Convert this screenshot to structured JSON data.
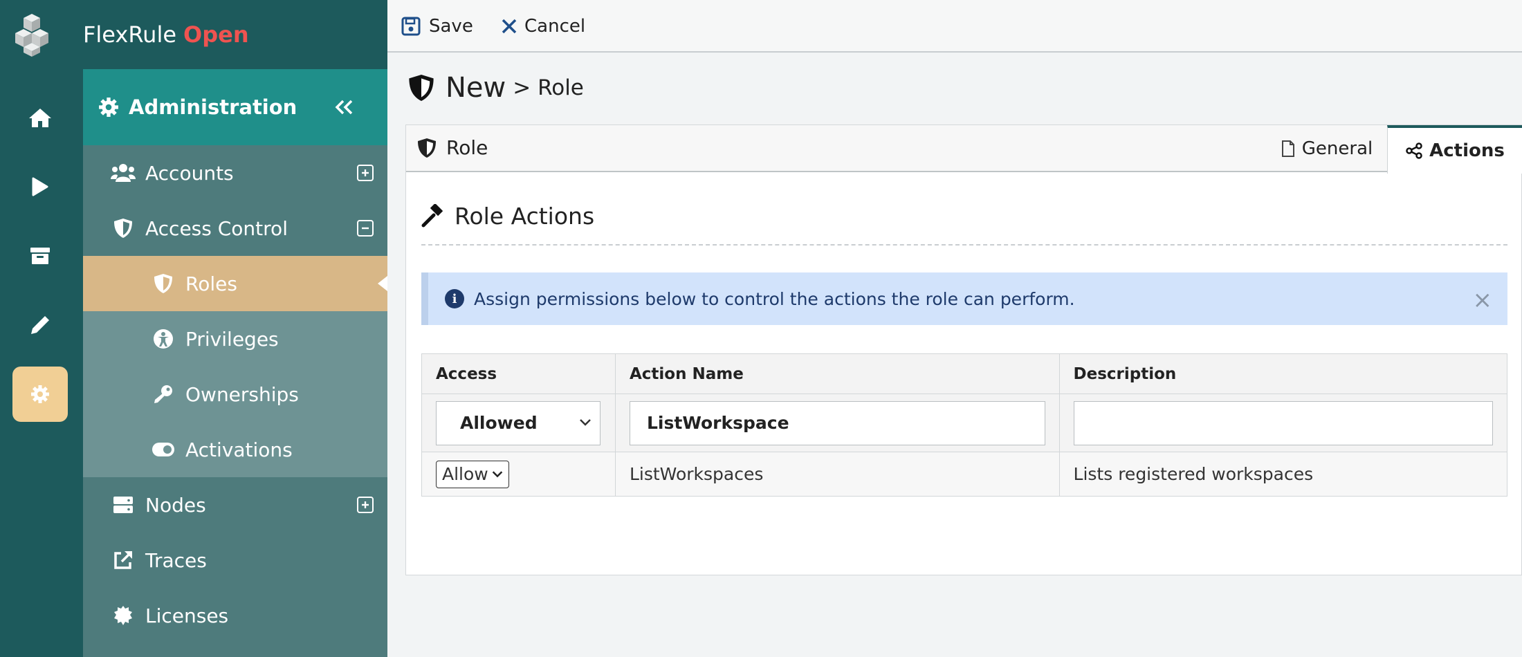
{
  "brand": {
    "name": "FlexRule",
    "edition": "Open"
  },
  "rail": {
    "icons": [
      "home-icon",
      "play-icon",
      "archive-icon",
      "pencil-icon",
      "gear-icon"
    ],
    "active": "gear-icon"
  },
  "sidebar": {
    "header": "Administration",
    "items": [
      {
        "label": "Accounts",
        "icon": "users-icon",
        "expand": "plus"
      },
      {
        "label": "Access Control",
        "icon": "shield-icon",
        "expand": "minus"
      },
      {
        "label": "Roles",
        "icon": "shield-icon",
        "sub": true,
        "selected": true
      },
      {
        "label": "Privileges",
        "icon": "person-icon",
        "sub": true
      },
      {
        "label": "Ownerships",
        "icon": "key-icon",
        "sub": true
      },
      {
        "label": "Activations",
        "icon": "toggle-icon",
        "sub": true
      },
      {
        "label": "Nodes",
        "icon": "server-icon",
        "expand": "plus"
      },
      {
        "label": "Traces",
        "icon": "external-link-icon"
      },
      {
        "label": "Licenses",
        "icon": "badge-icon"
      }
    ]
  },
  "toolbar": {
    "save_label": "Save",
    "cancel_label": "Cancel"
  },
  "page": {
    "title_new": "New",
    "title_sep": "> Role"
  },
  "panel": {
    "title": "Role",
    "tabs": {
      "general": "General",
      "actions": "Actions"
    },
    "section_title": "Role Actions",
    "alert": "Assign permissions below to control the actions the role can perform.",
    "alert_close": "×"
  },
  "table": {
    "headers": {
      "access": "Access",
      "action": "Action Name",
      "description": "Description"
    },
    "filter": {
      "access": "Allowed",
      "action": "ListWorkspace",
      "description": ""
    },
    "rows": [
      {
        "access": "Allow",
        "action": "ListWorkspaces",
        "description": "Lists registered workspaces"
      }
    ]
  },
  "colors": {
    "rail": "#1d5a5c",
    "accent_teal": "#1f8f8a",
    "selected": "#d8b787",
    "brand_open": "#ef5350"
  }
}
